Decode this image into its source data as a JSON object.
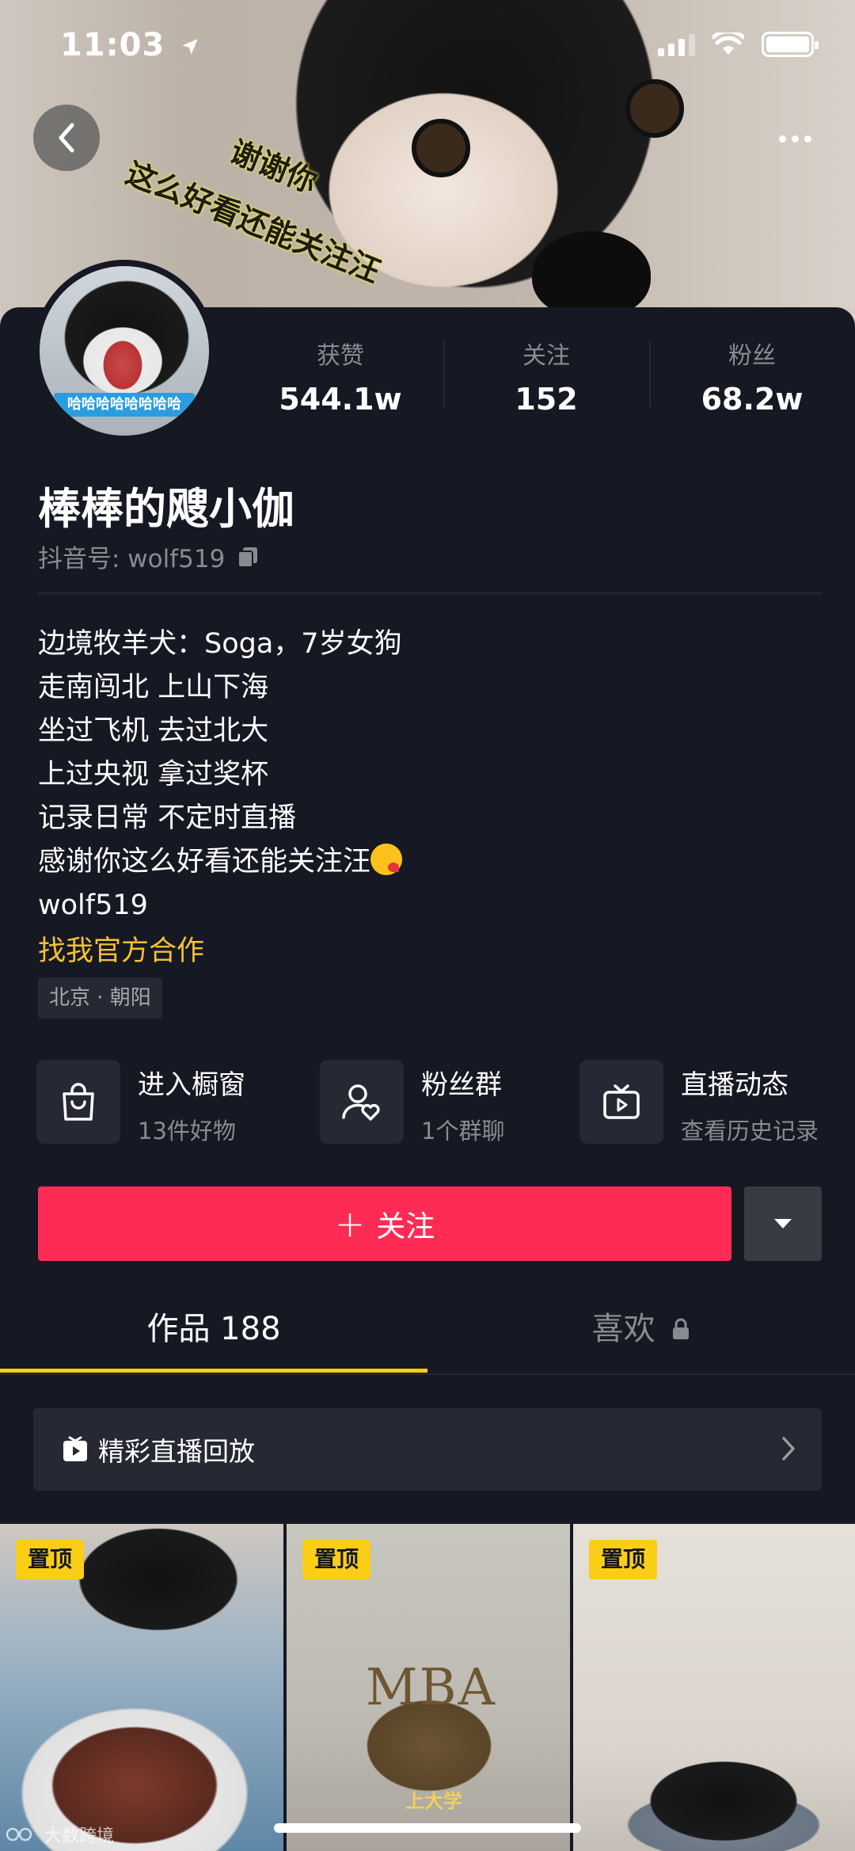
{
  "status_bar": {
    "time": "11:03"
  },
  "cover": {
    "scribble_line1": "谢谢你",
    "scribble_line2": "这么好看还能关注汪"
  },
  "profile": {
    "avatar_caption": "哈哈哈哈哈哈哈哈",
    "stats": [
      {
        "label": "获赞",
        "value": "544.1w"
      },
      {
        "label": "关注",
        "value": "152"
      },
      {
        "label": "粉丝",
        "value": "68.2w"
      }
    ],
    "nickname": "棒棒的飕小伽",
    "douyin_id": "抖音号: wolf519",
    "bio": [
      "边境牧羊犬：Soga，7岁女狗",
      "走南闯北 上山下海",
      "坐过飞机 去过北大",
      "上过央视 拿过奖杯",
      "记录日常 不定时直播",
      "感谢你这么好看还能关注汪",
      "wolf519"
    ],
    "cooperation_link": "找我官方合作",
    "location": "北京 · 朝阳"
  },
  "features": [
    {
      "title": "进入橱窗",
      "subtitle": "13件好物",
      "icon": "shopping-bag-icon"
    },
    {
      "title": "粉丝群",
      "subtitle": "1个群聊",
      "icon": "fan-group-icon"
    },
    {
      "title": "直播动态",
      "subtitle": "查看历史记录",
      "icon": "tv-play-icon"
    }
  ],
  "actions": {
    "follow_label": "关注",
    "follow_plus": "+"
  },
  "tabs": [
    {
      "label": "作品 188",
      "active": true
    },
    {
      "label": "喜欢",
      "active": false
    }
  ],
  "live_replay": {
    "label": "精彩直播回放"
  },
  "videos": [
    {
      "pin_label": "置顶"
    },
    {
      "pin_label": "置顶",
      "sign_text": "MBA",
      "caption": "上大学"
    },
    {
      "pin_label": "置顶"
    }
  ],
  "watermark": "大数跨境",
  "colors": {
    "background": "#161823",
    "follow_button": "#fe2c55",
    "accent_yellow": "#face15",
    "link_yellow": "#f4c231",
    "muted_text": "#8a8b91"
  }
}
